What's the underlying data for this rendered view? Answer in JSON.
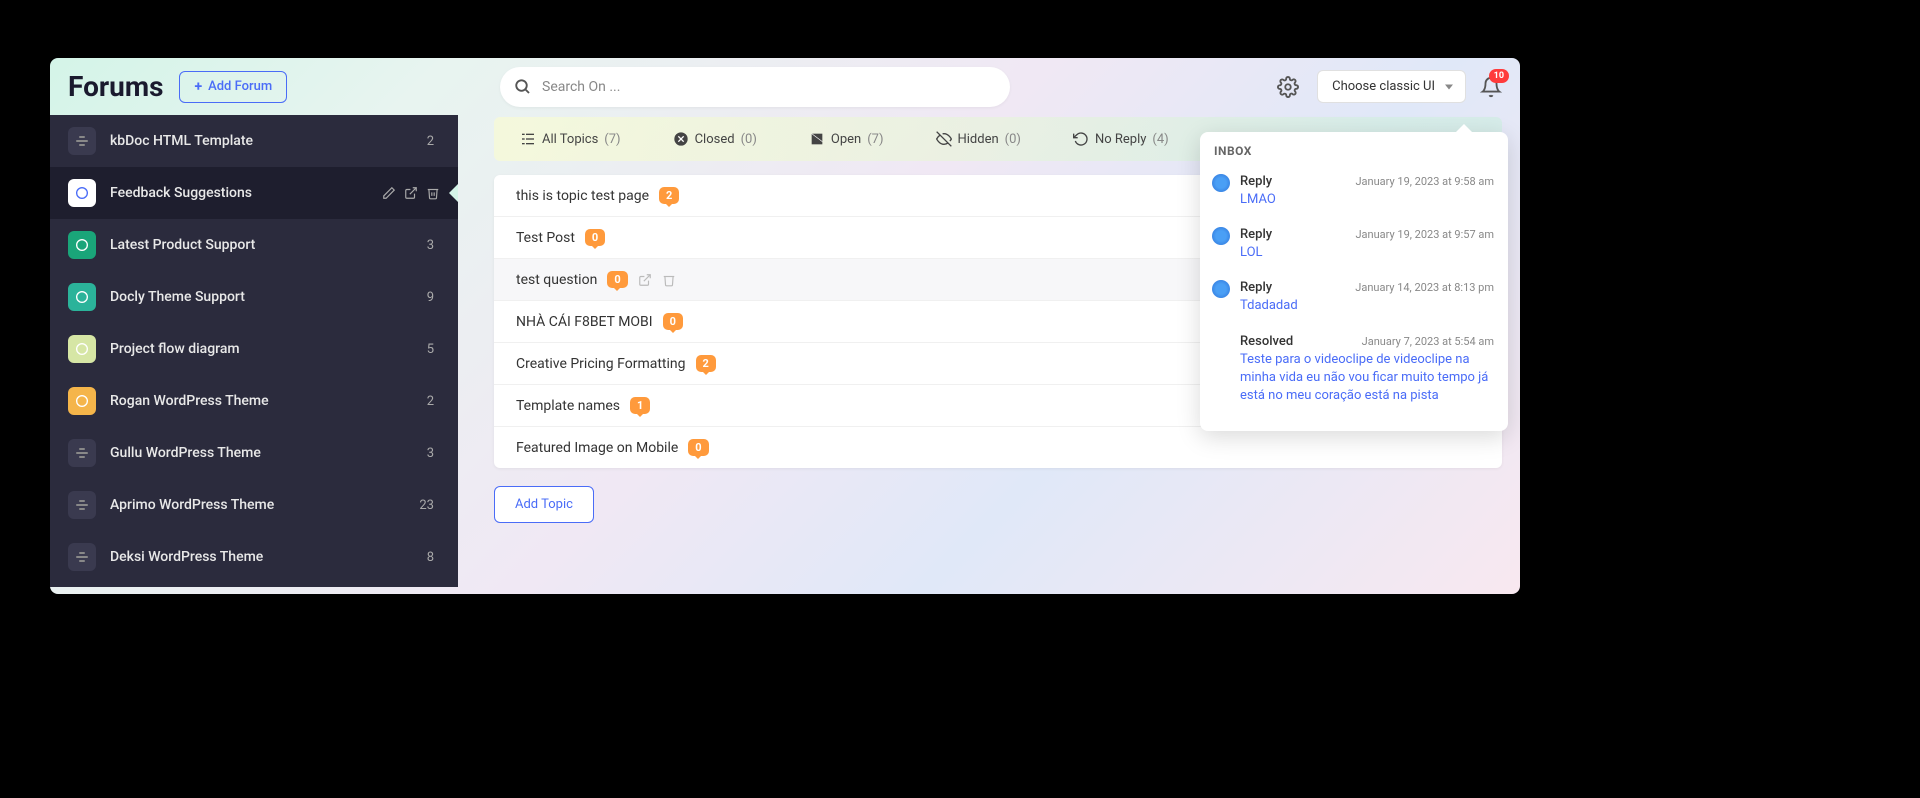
{
  "header": {
    "title": "Forums",
    "add_forum_label": "Add Forum",
    "search_placeholder": "Search On ...",
    "ui_select_label": "Choose classic UI",
    "notification_count": "10"
  },
  "sidebar": {
    "items": [
      {
        "label": "kbDoc HTML Template",
        "count": "2",
        "icon_bg": "#3a3a4f"
      },
      {
        "label": "Feedback Suggestions",
        "count": "",
        "icon_bg": "#ffffff",
        "active": true
      },
      {
        "label": "Latest Product Support",
        "count": "3",
        "icon_bg": "#1aa579"
      },
      {
        "label": "Docly Theme Support",
        "count": "9",
        "icon_bg": "#2bb39a"
      },
      {
        "label": "Project flow diagram",
        "count": "5",
        "icon_bg": "#d6e6a5"
      },
      {
        "label": "Rogan WordPress Theme",
        "count": "2",
        "icon_bg": "#f5b54a"
      },
      {
        "label": "Gullu WordPress Theme",
        "count": "3",
        "icon_bg": "#3a3a4f"
      },
      {
        "label": "Aprimo WordPress Theme",
        "count": "23",
        "icon_bg": "#3a3a4f"
      },
      {
        "label": "Deksi WordPress Theme",
        "count": "8",
        "icon_bg": "#3a3a4f"
      }
    ]
  },
  "tabs": [
    {
      "label": "All Topics",
      "count": "(7)"
    },
    {
      "label": "Closed",
      "count": "(0)"
    },
    {
      "label": "Open",
      "count": "(7)"
    },
    {
      "label": "Hidden",
      "count": "(0)"
    },
    {
      "label": "No Reply",
      "count": "(4)"
    }
  ],
  "topics": [
    {
      "title": "this is topic test page",
      "badge": "2"
    },
    {
      "title": "Test Post",
      "badge": "0"
    },
    {
      "title": "test question",
      "badge": "0",
      "hover": true
    },
    {
      "title": "NHÀ CÁI F8BET MOBI",
      "badge": "0"
    },
    {
      "title": "Creative Pricing Formatting",
      "badge": "2"
    },
    {
      "title": "Template names",
      "badge": "1"
    },
    {
      "title": "Featured Image on Mobile",
      "badge": "0"
    }
  ],
  "add_topic_label": "Add Topic",
  "inbox": {
    "title": "INBOX",
    "items": [
      {
        "label": "Reply",
        "time": "January 19, 2023 at 9:58 am",
        "body": "LMAO",
        "avatar": true
      },
      {
        "label": "Reply",
        "time": "January 19, 2023 at 9:57 am",
        "body": "LOL",
        "avatar": true
      },
      {
        "label": "Reply",
        "time": "January 14, 2023 at 8:13 pm",
        "body": "Tdadadad",
        "avatar": true
      },
      {
        "label": "Resolved",
        "time": "January 7, 2023 at 5:54 am",
        "body": "Teste para o videoclipe de videoclipe na minha vida eu não vou ficar muito tempo já está no meu coração está na pista",
        "avatar": false
      }
    ]
  }
}
